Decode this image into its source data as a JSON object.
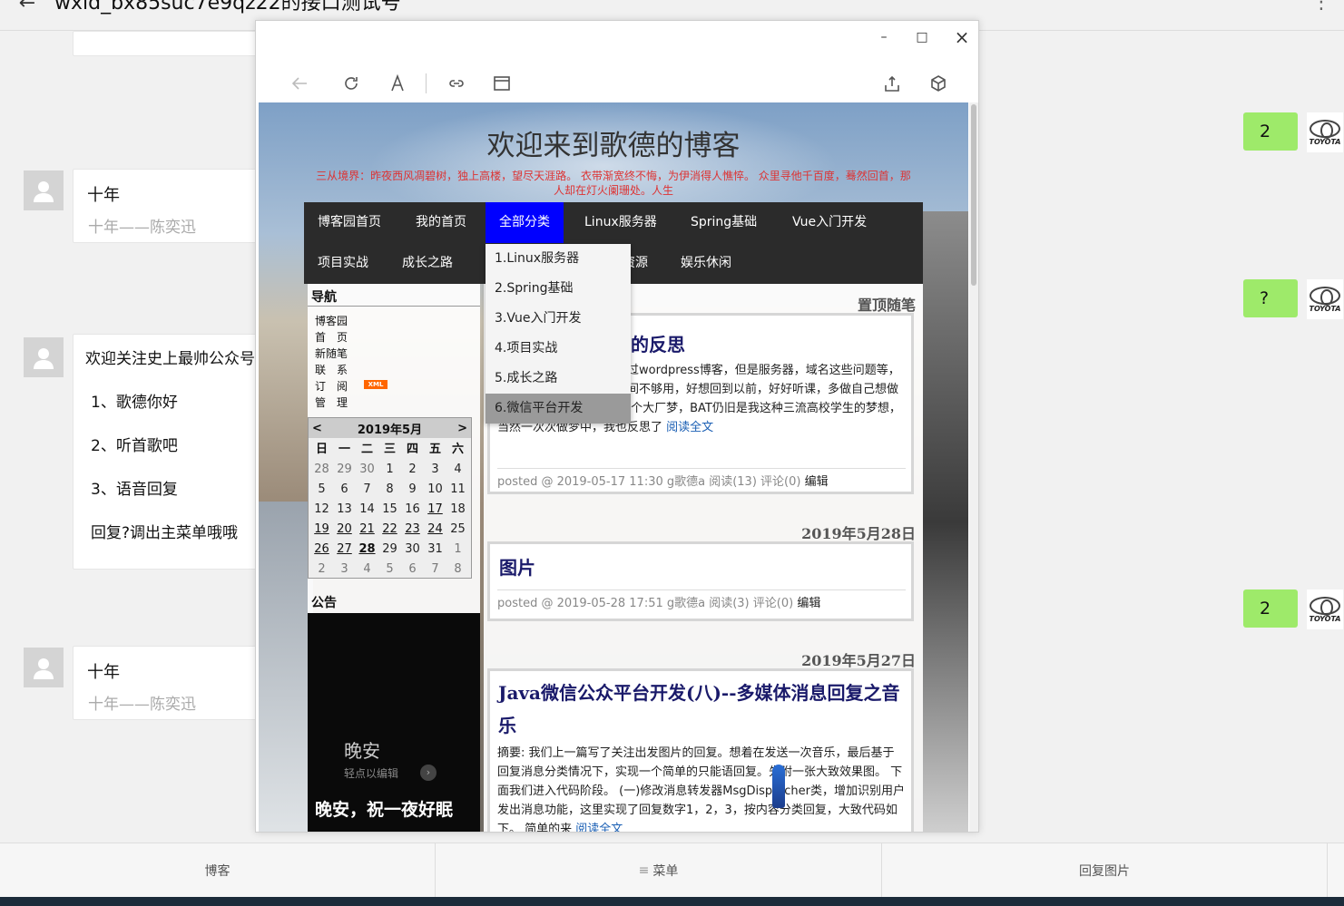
{
  "chat": {
    "title": "wxid_bx85suc7e9qz22的接口测试号",
    "messages": [
      {
        "title": "十年",
        "sub": "十年——陈奕迅"
      },
      {
        "lines": [
          "欢迎关注史上最帅公众号",
          "1、歌德你好",
          "2、听首歌吧",
          "3、语音回复",
          "回复?调出主菜单哦哦"
        ]
      },
      {
        "title": "十年",
        "sub": "十年——陈奕迅"
      }
    ],
    "sent": [
      "2",
      "?",
      "2"
    ],
    "toyota_label": "TOYOTA",
    "bottom_menu": [
      "博客",
      "菜单",
      "回复图片"
    ],
    "menu_icon": "≡"
  },
  "browser": {
    "window_buttons": {
      "minimize": "–",
      "maximize": "□",
      "close": "×"
    },
    "blog_title": "欢迎来到歌德的博客",
    "blog_subtitle": "三从境界：昨夜西风凋碧树，独上高楼，望尽天涯路。 衣带渐宽终不悔，为伊消得人憔悴。 众里寻他千百度，蓦然回首，那人却在灯火阑珊处。人生",
    "nav_row1": [
      "博客园首页",
      "我的首页",
      "全部分类",
      "Linux服务器",
      "Spring基础",
      "Vue入门开发"
    ],
    "nav_row2": [
      "项目实战",
      "成长之路",
      "资源",
      "娱乐休闲"
    ],
    "dropdown": [
      "1.Linux服务器",
      "2.Spring基础",
      "3.Vue入门开发",
      "4.项目实战",
      "5.成长之路",
      "6.微信平台开发"
    ],
    "sidebar": {
      "nav_title": "导航",
      "links": [
        "博客园",
        "首　页",
        "新随笔",
        "联　系",
        "订　阅",
        "管　理"
      ],
      "xml_badge": "XML",
      "calendar": {
        "prev": "<",
        "next": ">",
        "month": "2019年5月",
        "weekdays": [
          "日",
          "一",
          "二",
          "三",
          "四",
          "五",
          "六"
        ],
        "rows": [
          [
            "28",
            "29",
            "30",
            "1",
            "2",
            "3",
            "4"
          ],
          [
            "5",
            "6",
            "7",
            "8",
            "9",
            "10",
            "11"
          ],
          [
            "12",
            "13",
            "14",
            "15",
            "16",
            "17",
            "18"
          ],
          [
            "19",
            "20",
            "21",
            "22",
            "23",
            "24",
            "25"
          ],
          [
            "26",
            "27",
            "28",
            "29",
            "30",
            "31",
            "1"
          ],
          [
            "2",
            "3",
            "4",
            "5",
            "6",
            "7",
            "8"
          ]
        ]
      },
      "notice_title": "公告",
      "notice_img": {
        "title": "晚安",
        "hint": "轻点以编辑",
        "caption": "晚安，祝一夜好眠"
      }
    },
    "pinned_label": "置顶随笔",
    "posts": [
      {
        "title": "的反思",
        "text": "就即将过去，以前自己整过wordpress博客，但是服务器，域名这些问题等，最后还是选择了博客是时间不够用，好想回到以前，好好听课，多做自己想做的事情。 自己一直有着一个大厂梦，BAT仍旧是我这种三流高校学生的梦想，当然一次次做梦中，我也反思了",
        "readmore": "阅读全文",
        "foot": "posted @ 2019-05-17 11:30 g歌德a 阅读(13) 评论(0)",
        "edit": "编辑"
      },
      {
        "date": "2019年5月28日",
        "title": "图片",
        "foot": "posted @ 2019-05-28 17:51 g歌德a 阅读(3) 评论(0)",
        "edit": "编辑"
      },
      {
        "date": "2019年5月27日",
        "title": "Java微信公众平台开发(八)--多媒体消息回复之音乐",
        "text": "摘要: 我们上一篇写了关注出发图片的回复。想着在发送一次音乐，最后基于回复消息分类情况下，实现一个简单的只能语回复。先附一张大致效果图。 下面我们进入代码阶段。 (一)修改消息转发器MsgDispatcher类，增加识别用户发出消息功能，这里实现了回复数字1，2，3，按内容分类回复，大致代码如下。 简单的来",
        "readmore": "阅读全文"
      }
    ]
  }
}
